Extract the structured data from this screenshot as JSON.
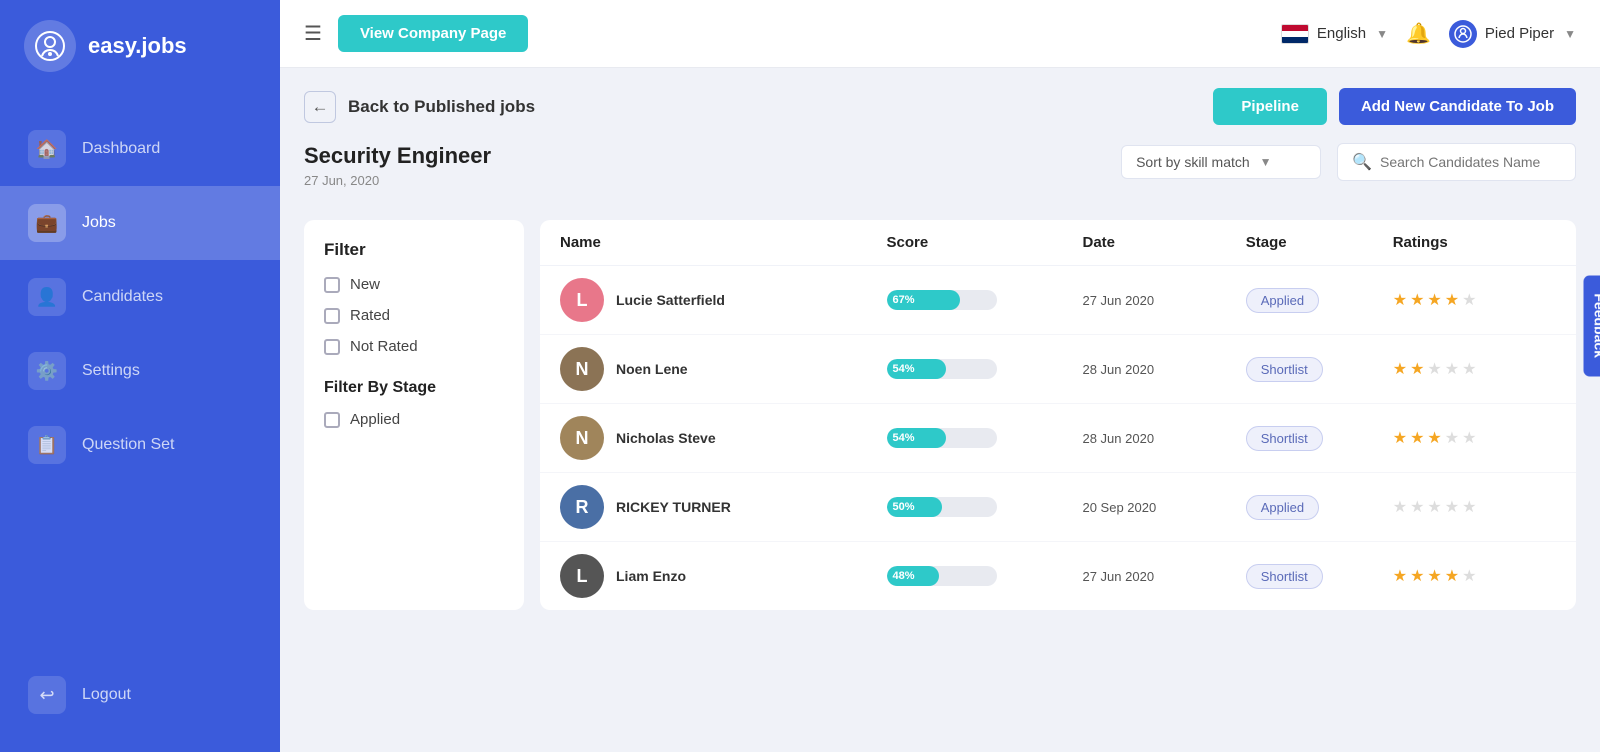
{
  "app": {
    "name": "easy.jobs",
    "logo_char": "Q"
  },
  "sidebar": {
    "nav_items": [
      {
        "id": "dashboard",
        "label": "Dashboard",
        "icon": "🏠",
        "active": false
      },
      {
        "id": "jobs",
        "label": "Jobs",
        "icon": "💼",
        "active": true
      },
      {
        "id": "candidates",
        "label": "Candidates",
        "icon": "👤",
        "active": false
      },
      {
        "id": "settings",
        "label": "Settings",
        "icon": "⚙️",
        "active": false
      },
      {
        "id": "question-set",
        "label": "Question Set",
        "icon": "📋",
        "active": false
      }
    ],
    "logout_label": "Logout"
  },
  "topbar": {
    "menu_icon": "☰",
    "view_company_btn": "View Company Page",
    "language": "English",
    "company_name": "Pied Piper",
    "bell_icon": "🔔"
  },
  "page": {
    "back_label": "Back to Published jobs",
    "pipeline_btn": "Pipeline",
    "add_candidate_btn": "Add New Candidate To Job",
    "job_title": "Security Engineer",
    "job_date": "27 Jun, 2020",
    "sort_placeholder": "Sort by skill match",
    "search_placeholder": "Search Candidates Name"
  },
  "filter": {
    "title": "Filter",
    "options": [
      {
        "id": "new",
        "label": "New"
      },
      {
        "id": "rated",
        "label": "Rated"
      },
      {
        "id": "not-rated",
        "label": "Not Rated"
      }
    ],
    "stage_title": "Filter By Stage",
    "stage_options": [
      {
        "id": "applied",
        "label": "Applied"
      }
    ]
  },
  "table": {
    "headers": [
      "Name",
      "Score",
      "Date",
      "Stage",
      "Ratings"
    ],
    "candidates": [
      {
        "id": 1,
        "name": "Lucie Satterfield",
        "avatar_color": "#e8778a",
        "avatar_char": "L",
        "score": 67,
        "date": "27 Jun 2020",
        "stage": "Applied",
        "stars": [
          1,
          1,
          1,
          1,
          0
        ]
      },
      {
        "id": 2,
        "name": "Noen Lene",
        "avatar_color": "#8b7355",
        "avatar_char": "N",
        "score": 54,
        "date": "28 Jun 2020",
        "stage": "Shortlist",
        "stars": [
          1,
          1,
          0,
          0,
          0
        ]
      },
      {
        "id": 3,
        "name": "Nicholas Steve",
        "avatar_color": "#a0855b",
        "avatar_char": "N",
        "score": 54,
        "date": "28 Jun 2020",
        "stage": "Shortlist",
        "stars": [
          1,
          1,
          1,
          0,
          0
        ]
      },
      {
        "id": 4,
        "name": "RICKEY TURNER",
        "avatar_color": "#4a6fa5",
        "avatar_char": "R",
        "score": 50,
        "date": "20 Sep 2020",
        "stage": "Applied",
        "stars": [
          0,
          0,
          0,
          0,
          0
        ]
      },
      {
        "id": 5,
        "name": "Liam Enzo",
        "avatar_color": "#555",
        "avatar_char": "L",
        "score": 48,
        "date": "27 Jun 2020",
        "stage": "Shortlist",
        "stars": [
          1,
          1,
          1,
          1,
          0
        ]
      }
    ]
  },
  "feedback": {
    "label": "Feedback"
  }
}
